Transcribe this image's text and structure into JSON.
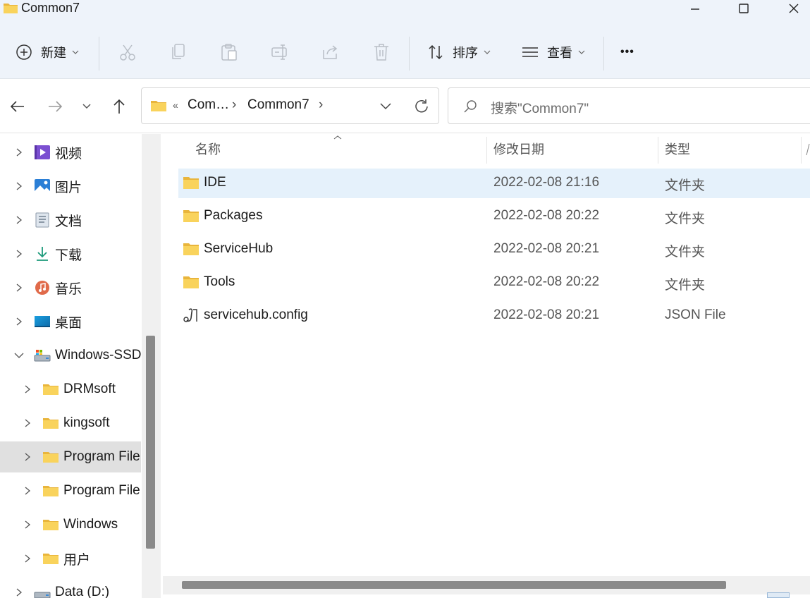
{
  "window": {
    "title": "Common7"
  },
  "toolbar": {
    "new_label": "新建",
    "sort_label": "排序",
    "view_label": "查看",
    "more_label": "•••"
  },
  "address": {
    "crumb_overflow": "«",
    "crumb_1": "Com…",
    "crumb_2": "Common7",
    "crumb_sep": "›"
  },
  "search": {
    "placeholder": "搜索\"Common7\""
  },
  "nav": {
    "items": [
      {
        "label": "视频",
        "icon": "video-icon"
      },
      {
        "label": "图片",
        "icon": "pictures-icon"
      },
      {
        "label": "文档",
        "icon": "documents-icon"
      },
      {
        "label": "下载",
        "icon": "download-icon"
      },
      {
        "label": "音乐",
        "icon": "music-icon"
      },
      {
        "label": "桌面",
        "icon": "desktop-icon"
      },
      {
        "label": "Windows-SSD",
        "icon": "drive-icon"
      },
      {
        "label": "DRMsoft",
        "icon": "folder-icon"
      },
      {
        "label": "kingsoft",
        "icon": "folder-icon"
      },
      {
        "label": "Program File",
        "icon": "folder-icon"
      },
      {
        "label": "Program File",
        "icon": "folder-icon"
      },
      {
        "label": "Windows",
        "icon": "folder-icon"
      },
      {
        "label": "用户",
        "icon": "folder-icon"
      },
      {
        "label": "Data (D:)",
        "icon": "drive-icon"
      }
    ]
  },
  "columns": {
    "name": "名称",
    "date": "修改日期",
    "type": "类型"
  },
  "files": [
    {
      "name": "IDE",
      "date": "2022-02-08 21:16",
      "type": "文件夹",
      "icon": "folder-icon"
    },
    {
      "name": "Packages",
      "date": "2022-02-08 20:22",
      "type": "文件夹",
      "icon": "folder-icon"
    },
    {
      "name": "ServiceHub",
      "date": "2022-02-08 20:21",
      "type": "文件夹",
      "icon": "folder-icon"
    },
    {
      "name": "Tools",
      "date": "2022-02-08 20:22",
      "type": "文件夹",
      "icon": "folder-icon"
    },
    {
      "name": "servicehub.config",
      "date": "2022-02-08 20:21",
      "type": "JSON File",
      "icon": "json-file-icon"
    }
  ],
  "colors": {
    "chrome_bg": "#eef3fa",
    "selected_row": "#e5f1fb",
    "folder_yellow": "#f7c948"
  }
}
